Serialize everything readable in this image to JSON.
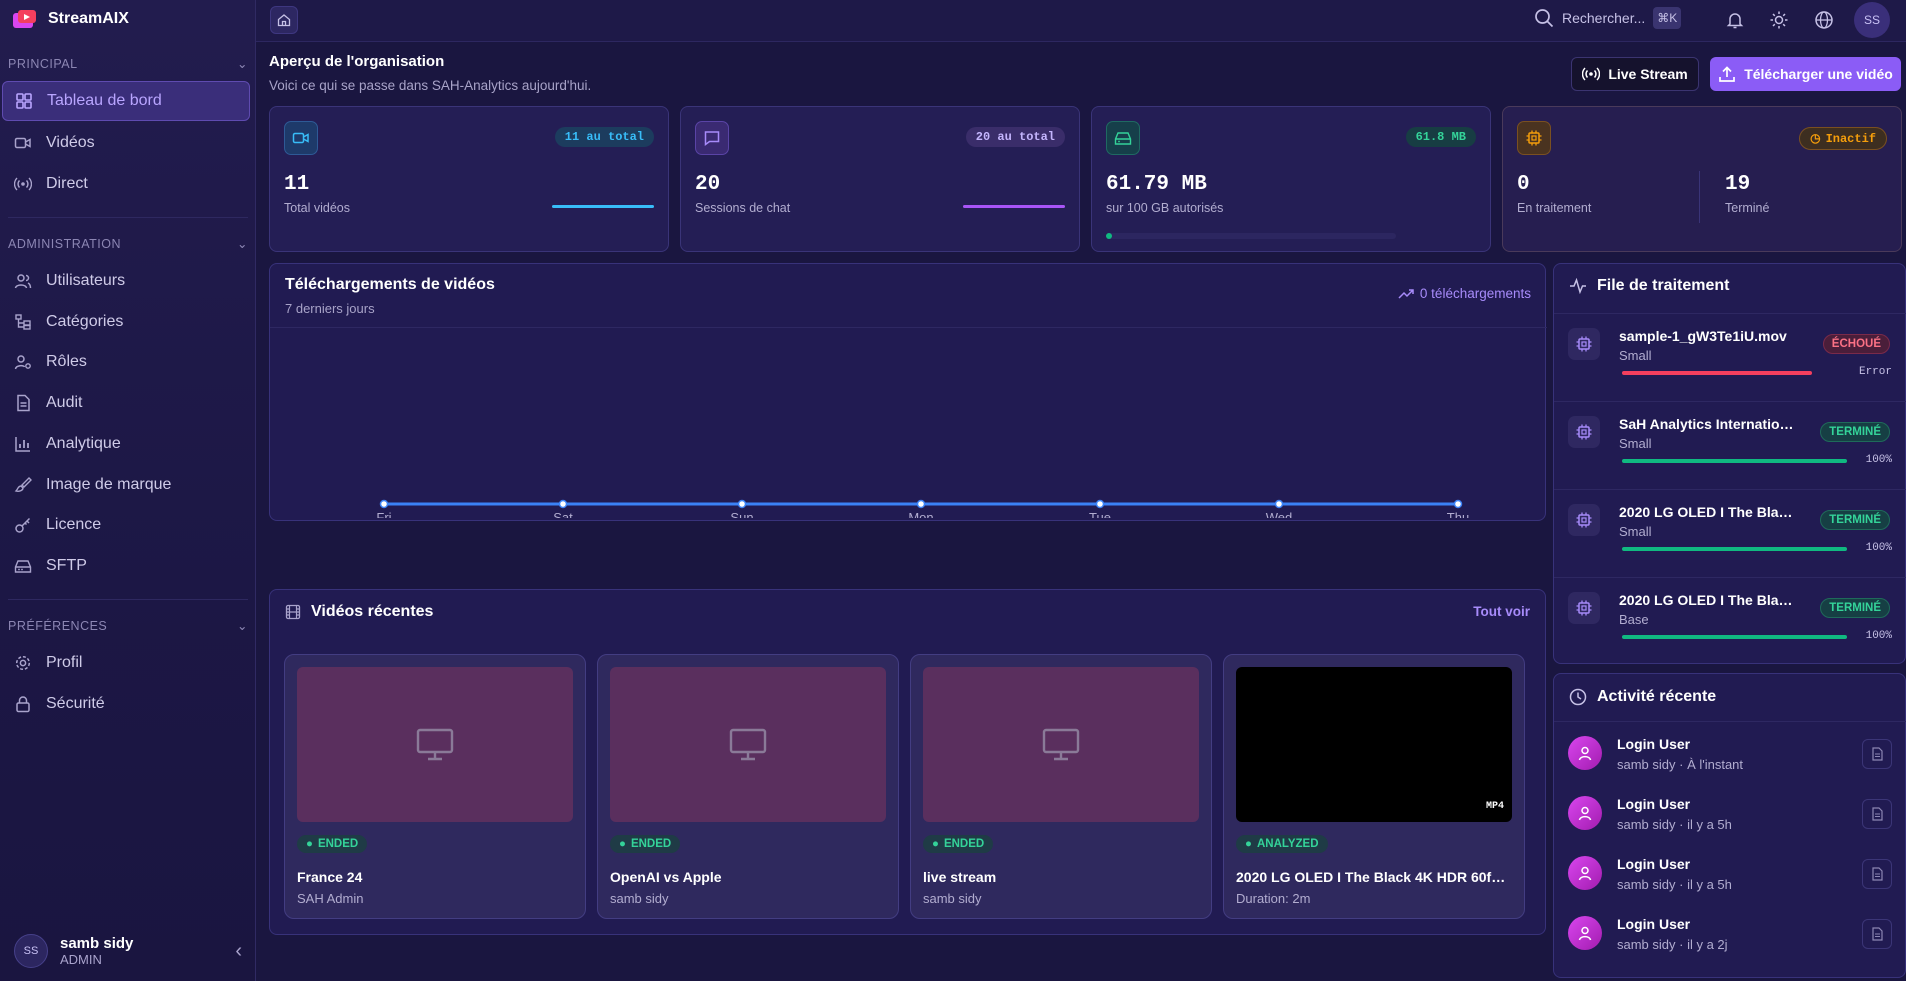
{
  "app": {
    "name": "StreamAIX"
  },
  "sidebar": {
    "sections": [
      {
        "title": "PRINCIPAL",
        "items": [
          {
            "label": "Tableau de bord",
            "icon": "dashboard-icon",
            "active": true
          },
          {
            "label": "Vidéos",
            "icon": "video-icon"
          },
          {
            "label": "Direct",
            "icon": "broadcast-icon"
          }
        ]
      },
      {
        "title": "ADMINISTRATION",
        "items": [
          {
            "label": "Utilisateurs",
            "icon": "users-icon"
          },
          {
            "label": "Catégories",
            "icon": "categories-icon"
          },
          {
            "label": "Rôles",
            "icon": "roles-icon"
          },
          {
            "label": "Audit",
            "icon": "audit-icon"
          },
          {
            "label": "Analytique",
            "icon": "analytics-icon"
          },
          {
            "label": "Image de marque",
            "icon": "brush-icon"
          },
          {
            "label": "Licence",
            "icon": "key-icon"
          },
          {
            "label": "SFTP",
            "icon": "drive-icon"
          }
        ]
      },
      {
        "title": "PRÉFÉRENCES",
        "items": [
          {
            "label": "Profil",
            "icon": "gear-icon"
          },
          {
            "label": "Sécurité",
            "icon": "lock-icon"
          }
        ]
      }
    ],
    "user": {
      "initials": "SS",
      "name": "samb sidy",
      "role": "ADMIN"
    }
  },
  "topbar": {
    "search_placeholder": "Rechercher...",
    "shortcut": "⌘K",
    "avatar": "SS"
  },
  "header": {
    "title": "Aperçu de l'organisation",
    "subtitle": "Voici ce qui se passe dans SAH-Analytics aujourd'hui.",
    "live_button": "Live Stream",
    "upload_button": "Télécharger une vidéo"
  },
  "stats": {
    "videos": {
      "value": "11",
      "label": "Total vidéos",
      "badge": "11 au total"
    },
    "chats": {
      "value": "20",
      "label": "Sessions de chat",
      "badge": "20 au total"
    },
    "storage": {
      "value": "61.79 MB",
      "label": "sur 100 GB autorisés",
      "badge": "61.8 MB",
      "usage_fraction": 0.0006
    },
    "processing": {
      "badge": "Inactif",
      "in_progress_value": "0",
      "in_progress_label": "En traitement",
      "done_value": "19",
      "done_label": "Terminé"
    }
  },
  "uploads_chart": {
    "title": "Téléchargements de vidéos",
    "subtitle": "7 derniers jours",
    "total_label": "0 téléchargements"
  },
  "chart_data": {
    "type": "line",
    "categories": [
      "Fri",
      "Sat",
      "Sun",
      "Mon",
      "Tue",
      "Wed",
      "Thu"
    ],
    "values": [
      0,
      0,
      0,
      0,
      0,
      0,
      0
    ],
    "title": "Téléchargements de vidéos",
    "xlabel": "",
    "ylabel": "",
    "grid": false,
    "color": "#3b82f6"
  },
  "recent_videos": {
    "title": "Vidéos récentes",
    "see_all": "Tout voir",
    "items": [
      {
        "status": "ENDED",
        "name": "France 24",
        "meta": "SAH Admin",
        "thumb": "placeholder"
      },
      {
        "status": "ENDED",
        "name": "OpenAI vs Apple",
        "meta": "samb sidy",
        "thumb": "placeholder"
      },
      {
        "status": "ENDED",
        "name": "live stream",
        "meta": "samb sidy",
        "thumb": "placeholder"
      },
      {
        "status": "ANALYZED",
        "name": "2020 LG OLED I The Black 4K HDR 60fps....",
        "meta": "Duration: 2m",
        "thumb": "black",
        "format": "MP4"
      }
    ]
  },
  "queue": {
    "title": "File de traitement",
    "items": [
      {
        "name": "sample-1_gW3Te1iU.mov",
        "size": "Small",
        "status": "ÉCHOUÉ",
        "progress_label": "Error",
        "progress": 1.0,
        "state": "error"
      },
      {
        "name": "SaH Analytics International...",
        "size": "Small",
        "status": "TERMINÉ",
        "progress_label": "100%",
        "progress": 1.0,
        "state": "done"
      },
      {
        "name": "2020 LG OLED I The Black ...",
        "size": "Small",
        "status": "TERMINÉ",
        "progress_label": "100%",
        "progress": 1.0,
        "state": "done"
      },
      {
        "name": "2020 LG OLED I The Black ...",
        "size": "Base",
        "status": "TERMINÉ",
        "progress_label": "100%",
        "progress": 1.0,
        "state": "done"
      }
    ]
  },
  "activity": {
    "title": "Activité récente",
    "items": [
      {
        "action": "Login User",
        "meta": "samb sidy · À l'instant"
      },
      {
        "action": "Login User",
        "meta": "samb sidy · il y a 5h"
      },
      {
        "action": "Login User",
        "meta": "samb sidy · il y a 5h"
      },
      {
        "action": "Login User",
        "meta": "samb sidy · il y a 2j"
      }
    ]
  },
  "colors": {
    "accent": "#8b5cf6",
    "success": "#10b981",
    "error": "#f43f5e",
    "info": "#38bdf8",
    "warning": "#f59e0b"
  }
}
